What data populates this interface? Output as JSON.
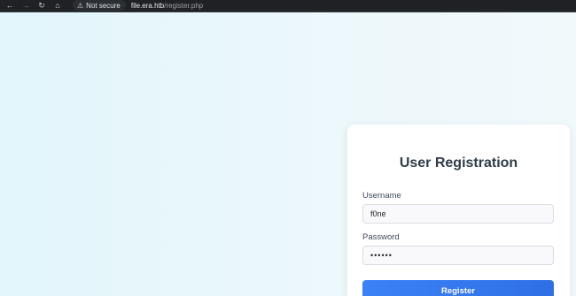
{
  "browser": {
    "security_label": "Not secure",
    "url_host": "file.era.htb",
    "url_path": "/register.php",
    "icons": [
      "back-icon",
      "forward-icon",
      "reload-icon",
      "home-icon",
      "warning-icon"
    ]
  },
  "form": {
    "title": "User Registration",
    "username_label": "Username",
    "username_value": "f0ne",
    "password_label": "Password",
    "password_value": "••••••",
    "submit_label": "Register"
  },
  "colors": {
    "accent": "#3b82f6",
    "page_bg": "#e6f5f8",
    "card_bg": "#ffffff",
    "title": "#2f3b49"
  }
}
